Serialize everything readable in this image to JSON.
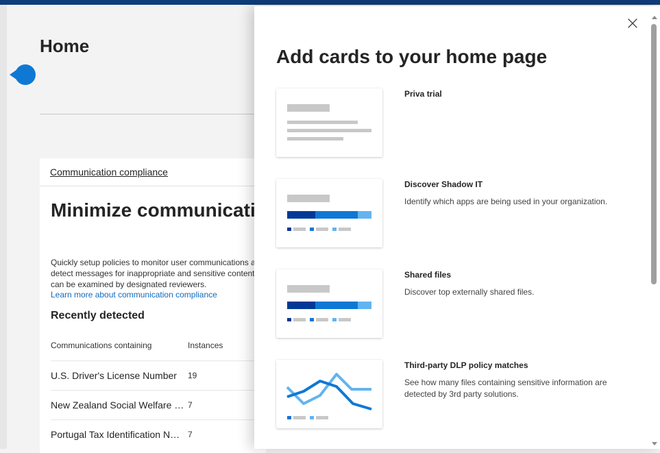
{
  "page": {
    "title": "Home"
  },
  "background_card": {
    "link": "Communication compliance",
    "heading": "Minimize communication risks",
    "description": "Quickly setup policies to monitor user communications and detect messages for inappropriate and sensitive content so they can be examined by designated reviewers.",
    "learn_more": "Learn more about communication compliance",
    "recently_detected": "Recently detected",
    "columns": [
      "Communications containing",
      "Instances"
    ],
    "rows": [
      {
        "name": "U.S. Driver's License Number",
        "count": "19"
      },
      {
        "name": "New Zealand Social Welfare Number",
        "count": "7"
      },
      {
        "name": "Portugal Tax Identification Number",
        "count": "7"
      }
    ]
  },
  "panel": {
    "title": "Add cards to your home page",
    "close_icon": "close-icon",
    "cards": [
      {
        "title": "Priva trial",
        "description": ""
      },
      {
        "title": "Discover Shadow IT",
        "description": "Identify which apps are being used in your organization."
      },
      {
        "title": "Shared files",
        "description": "Discover top externally shared files."
      },
      {
        "title": "Third-party DLP policy matches",
        "description": "See how many files containing sensitive information are detected by 3rd party solutions."
      }
    ]
  },
  "colors": {
    "accent": "#0f6cbd",
    "bar_dark": "#003a96",
    "bar_mid": "#0f78d4",
    "bar_light": "#62b4f0",
    "placeholder_gray": "#c8c8c8",
    "top_bar": "#0f3d7a"
  }
}
